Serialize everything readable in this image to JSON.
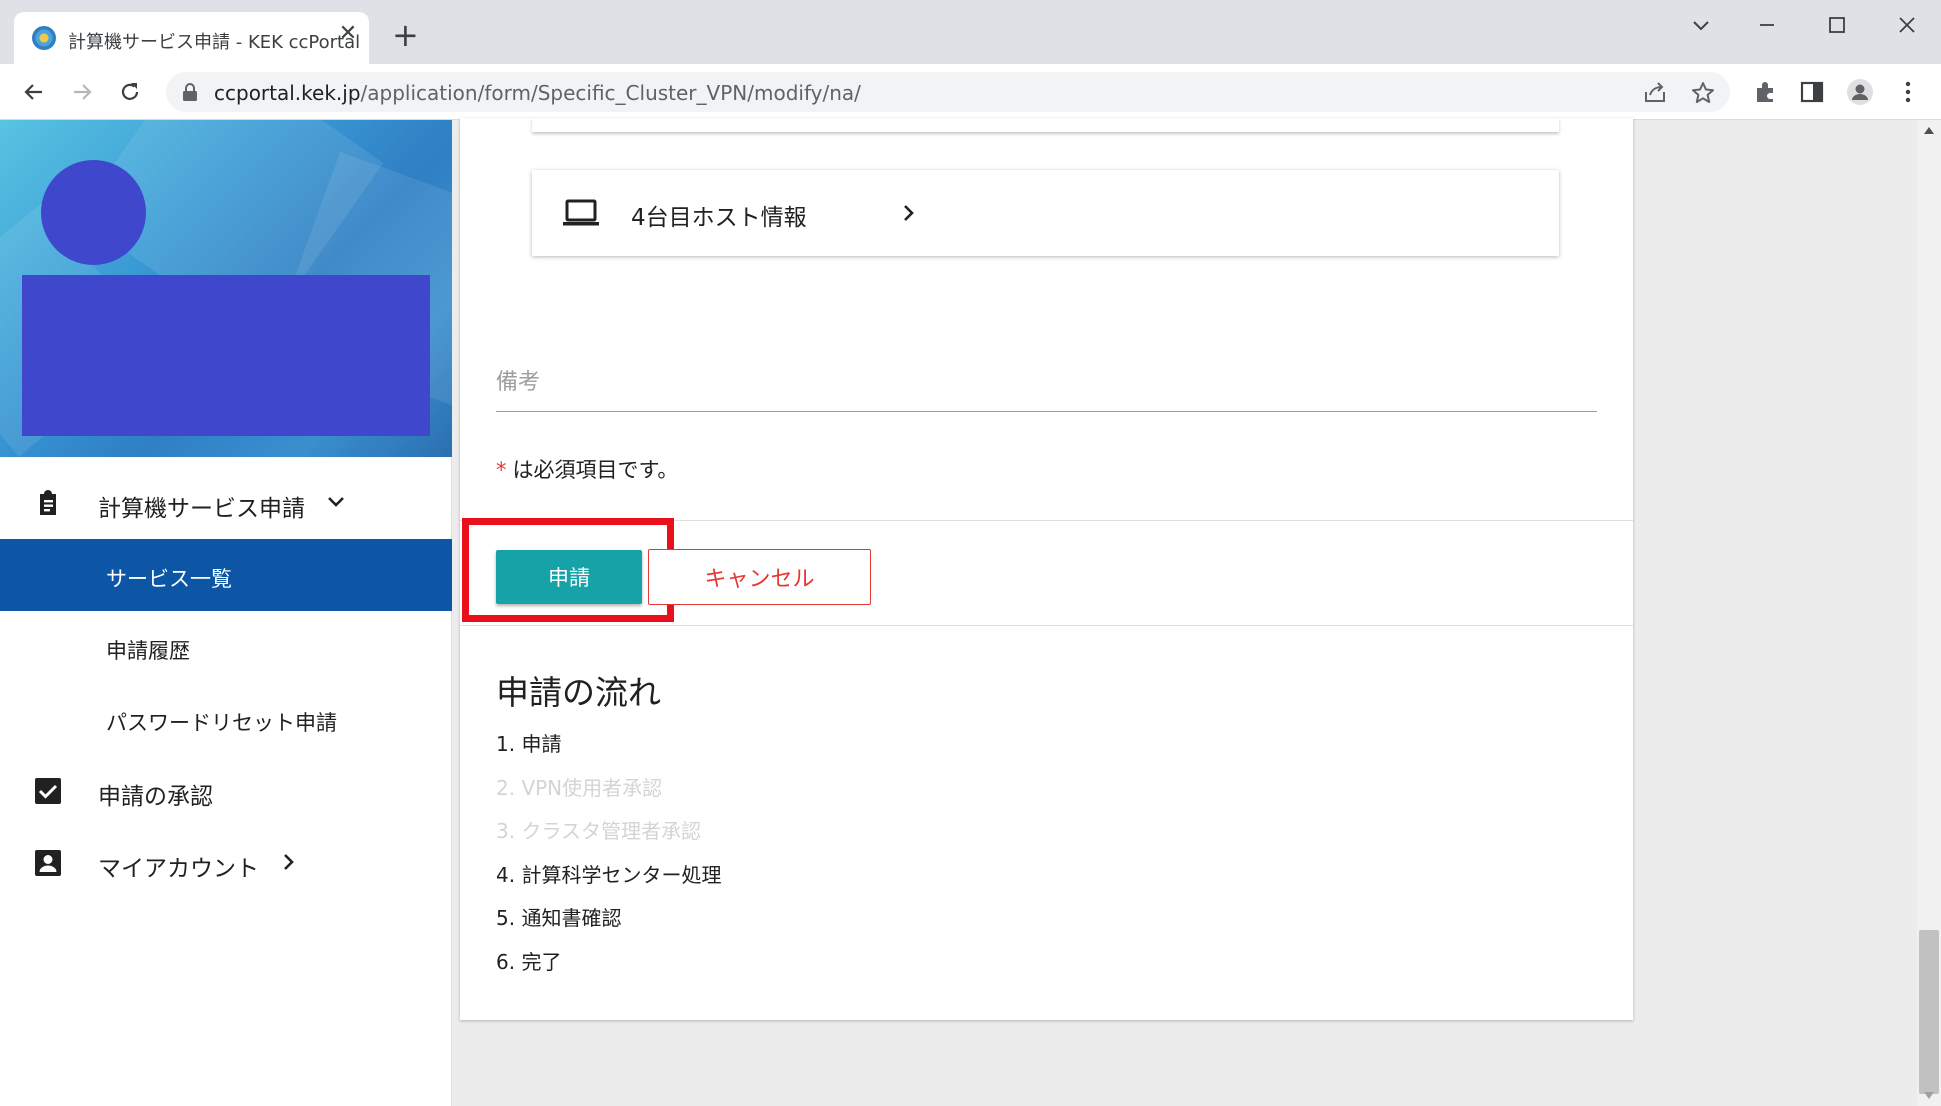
{
  "browser": {
    "tab_title": "計算機サービス申請 - KEK ccPortal",
    "url_host": "ccportal.kek.jp",
    "url_path": "/application/form/Specific_Cluster_VPN/modify/na/"
  },
  "sidebar": {
    "nav_service_application": "計算機サービス申請",
    "nav_service_list": "サービス一覧",
    "nav_application_history": "申請履歴",
    "nav_password_reset": "パスワードリセット申請",
    "nav_approval": "申請の承認",
    "nav_my_account": "マイアカウント"
  },
  "form": {
    "host4_label": "4台目ホスト情報",
    "remarks_placeholder": "備考",
    "required_star": "*",
    "required_note": "は必須項目です。",
    "submit_label": "申請",
    "cancel_label": "キャンセル"
  },
  "flow": {
    "title": "申請の流れ",
    "steps": [
      {
        "text": "1. 申請",
        "active": true
      },
      {
        "text": "2. VPN使用者承認",
        "active": false
      },
      {
        "text": "3. クラスタ管理者承認",
        "active": false
      },
      {
        "text": "4. 計算科学センター処理",
        "active": true
      },
      {
        "text": "5. 通知書確認",
        "active": true
      },
      {
        "text": "6. 完了",
        "active": true
      }
    ]
  },
  "colors": {
    "nav_active_bg": "#0d56a6",
    "submit_bg": "#17a2a8",
    "cancel": "#e53935",
    "highlight": "#e8101a",
    "redacted": "#3f47cc"
  }
}
